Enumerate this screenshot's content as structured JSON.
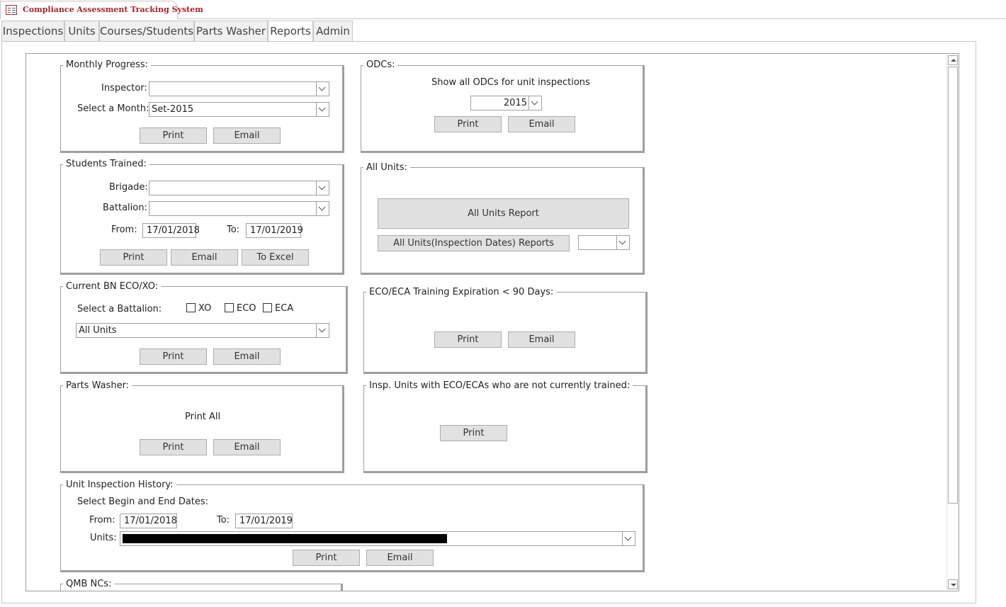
{
  "app": {
    "title": "Compliance Assessment Tracking System"
  },
  "tabs": [
    "Inspections",
    "Units",
    "Courses/Students",
    "Parts Washer",
    "Reports",
    "Admin"
  ],
  "active_tab": "Reports",
  "monthly_progress": {
    "title": "Monthly Progress:",
    "inspector_label": "Inspector:",
    "inspector_value": "",
    "month_label": "Select a Month:",
    "month_value": "Set-2015",
    "print": "Print",
    "email": "Email"
  },
  "odcs": {
    "title": "ODCs:",
    "caption": "Show all ODCs for unit inspections",
    "year_value": "2015",
    "print": "Print",
    "email": "Email"
  },
  "students_trained": {
    "title": "Students Trained:",
    "brigade_label": "Brigade:",
    "brigade_value": "",
    "battalion_label": "Battalion:",
    "battalion_value": "",
    "from_label": "From:",
    "from_value": "17/01/2018",
    "to_label": "To:",
    "to_value": "17/01/2019",
    "print": "Print",
    "email": "Email",
    "excel": "To Excel"
  },
  "all_units": {
    "title": "All Units:",
    "report_button": "All Units Report",
    "insp_dates_button": "All Units(Inspection Dates) Reports",
    "insp_dates_select": ""
  },
  "current_bn": {
    "title": "Current BN ECO/XO:",
    "select_label": "Select a Battalion:",
    "xo": "XO",
    "eco": "ECO",
    "eca": "ECA",
    "battalion_value": "All Units",
    "print": "Print",
    "email": "Email"
  },
  "eco_eca": {
    "title": "ECO/ECA Training Expiration < 90 Days:",
    "print": "Print",
    "email": "Email"
  },
  "parts_washer": {
    "title": "Parts Washer:",
    "caption": "Print All",
    "print": "Print",
    "email": "Email"
  },
  "insp_units": {
    "title": "Insp. Units with  ECO/ECAs who are not currently trained:",
    "print": "Print"
  },
  "unit_history": {
    "title": "Unit Inspection History:",
    "caption": "Select Begin and End Dates:",
    "from_label": "From:",
    "from_value": "17/01/2018",
    "to_label": "To:",
    "to_value": "17/01/2019",
    "units_label": "Units:",
    "print": "Print",
    "email": "Email"
  },
  "qmb": {
    "title": "QMB NCs:"
  },
  "colors": {
    "title_red": "#a4262c",
    "button_gray": "#e1e1e1",
    "border_gray": "#9e9e9e"
  }
}
